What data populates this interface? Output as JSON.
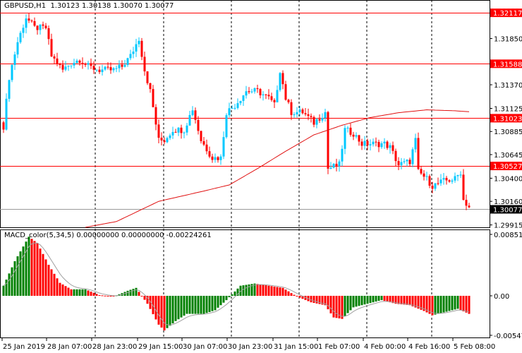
{
  "header": {
    "symbol": "GBPUSD,H1",
    "ohlc": "1.30123 1.30138 1.30070 1.30077"
  },
  "macd_header": {
    "name": "MACD_color(5,34,5)",
    "values": "0.00000000 0.00000000 -0.00224261"
  },
  "colors": {
    "up": "#00c8ff",
    "down": "#ff0000",
    "level": "#ff0000",
    "ma": "#e01010",
    "hist_up": "#008000",
    "hist_down": "#ff0000",
    "signal": "#a0a0a0"
  },
  "chart_data": {
    "type": "candlestick",
    "candle_count": 166,
    "price_range": [
      1.2989,
      1.3225
    ],
    "price_ticks": [
      "1.31850",
      "1.31370",
      "1.31125",
      "1.30885",
      "1.30645",
      "1.30400",
      "1.30160",
      "1.29915"
    ],
    "levels": [
      {
        "price": 1.32117,
        "label": "1.32117",
        "kind": "red"
      },
      {
        "price": 1.31588,
        "label": "1.31588",
        "kind": "red"
      },
      {
        "price": 1.31023,
        "label": "1.31023",
        "kind": "red"
      },
      {
        "price": 1.30527,
        "label": "1.30527",
        "kind": "red"
      },
      {
        "price": 1.30077,
        "label": "1.30077",
        "kind": "current"
      }
    ],
    "close_waypoints": [
      [
        0,
        1.3094
      ],
      [
        2,
        1.3145
      ],
      [
        5,
        1.31815
      ],
      [
        8,
        1.3207
      ],
      [
        11,
        1.31961
      ],
      [
        15,
        1.31961
      ],
      [
        17,
        1.31669
      ],
      [
        21,
        1.31523
      ],
      [
        24,
        1.31596
      ],
      [
        27,
        1.31633
      ],
      [
        30,
        1.3156
      ],
      [
        34,
        1.31523
      ],
      [
        39,
        1.31523
      ],
      [
        42,
        1.3156
      ],
      [
        45,
        1.31669
      ],
      [
        48,
        1.31851
      ],
      [
        50,
        1.31523
      ],
      [
        52,
        1.31304
      ],
      [
        55,
        1.30794
      ],
      [
        57,
        1.30794
      ],
      [
        60,
        1.30903
      ],
      [
        64,
        1.30903
      ],
      [
        67,
        1.31122
      ],
      [
        70,
        1.30794
      ],
      [
        74,
        1.30612
      ],
      [
        77,
        1.30612
      ],
      [
        79,
        1.31086
      ],
      [
        82,
        1.31158
      ],
      [
        86,
        1.31304
      ],
      [
        90,
        1.31304
      ],
      [
        94,
        1.31231
      ],
      [
        96,
        1.31158
      ],
      [
        98,
        1.31523
      ],
      [
        100,
        1.31231
      ],
      [
        102,
        1.31086
      ],
      [
        106,
        1.31086
      ],
      [
        110,
        1.30976
      ],
      [
        114,
        1.31086
      ],
      [
        115,
        1.30502
      ],
      [
        119,
        1.30539
      ],
      [
        121,
        1.30903
      ],
      [
        124,
        1.30867
      ],
      [
        127,
        1.30757
      ],
      [
        131,
        1.30757
      ],
      [
        135,
        1.30757
      ],
      [
        137,
        1.30721
      ],
      [
        140,
        1.30539
      ],
      [
        144,
        1.30575
      ],
      [
        146,
        1.30794
      ],
      [
        147,
        1.30466
      ],
      [
        150,
        1.30393
      ],
      [
        152,
        1.3032
      ],
      [
        156,
        1.30371
      ],
      [
        160,
        1.30393
      ],
      [
        162,
        1.30466
      ],
      [
        163,
        1.30174
      ],
      [
        165,
        1.30101
      ]
    ],
    "ma_waypoints": [
      [
        29,
        1.2989
      ],
      [
        40,
        1.2995
      ],
      [
        55,
        1.3016
      ],
      [
        70,
        1.3026
      ],
      [
        80,
        1.3033
      ],
      [
        90,
        1.305
      ],
      [
        100,
        1.3068
      ],
      [
        110,
        1.3085
      ],
      [
        120,
        1.3095
      ],
      [
        130,
        1.3103
      ],
      [
        140,
        1.3108
      ],
      [
        150,
        1.3111
      ],
      [
        160,
        1.311
      ],
      [
        165,
        1.3109
      ]
    ],
    "macd_range": [
      -0.005475,
      0.0085182
    ],
    "macd_ticks": [
      "0.0085182",
      "0.00",
      "-0.005475"
    ],
    "macd_waypoints": [
      [
        0,
        0.0014
      ],
      [
        4,
        0.0048
      ],
      [
        9,
        0.0082
      ],
      [
        12,
        0.0073
      ],
      [
        16,
        0.0043
      ],
      [
        20,
        0.0018
      ],
      [
        24,
        0.0009
      ],
      [
        29,
        0.0009
      ],
      [
        34,
        0.0001
      ],
      [
        39,
        -0.0001
      ],
      [
        44,
        0.0007
      ],
      [
        47,
        0.0011
      ],
      [
        51,
        -0.0011
      ],
      [
        55,
        -0.004
      ],
      [
        57,
        -0.0048
      ],
      [
        61,
        -0.0035
      ],
      [
        65,
        -0.0025
      ],
      [
        71,
        -0.0025
      ],
      [
        75,
        -0.002
      ],
      [
        79,
        -0.0006
      ],
      [
        84,
        0.0014
      ],
      [
        89,
        0.0017
      ],
      [
        94,
        0.0014
      ],
      [
        99,
        0.0011
      ],
      [
        104,
        -0.0001
      ],
      [
        109,
        -0.0009
      ],
      [
        114,
        -0.0013
      ],
      [
        117,
        -0.003
      ],
      [
        120,
        -0.0032
      ],
      [
        124,
        -0.0016
      ],
      [
        129,
        -0.0011
      ],
      [
        134,
        -0.0006
      ],
      [
        139,
        -0.0011
      ],
      [
        144,
        -0.0013
      ],
      [
        149,
        -0.0021
      ],
      [
        152,
        -0.0027
      ],
      [
        156,
        -0.0023
      ],
      [
        161,
        -0.0018
      ],
      [
        165,
        -0.0025
      ]
    ],
    "time_labels": [
      "25 Jan 2019",
      "28 Jan 07:00",
      "28 Jan 23:00",
      "29 Jan 15:00",
      "30 Jan 07:00",
      "30 Jan 23:00",
      "31 Jan 15:00",
      "1 Feb 07:00",
      "4 Feb 00:00",
      "4 Feb 16:00",
      "5 Feb 08:00"
    ]
  }
}
